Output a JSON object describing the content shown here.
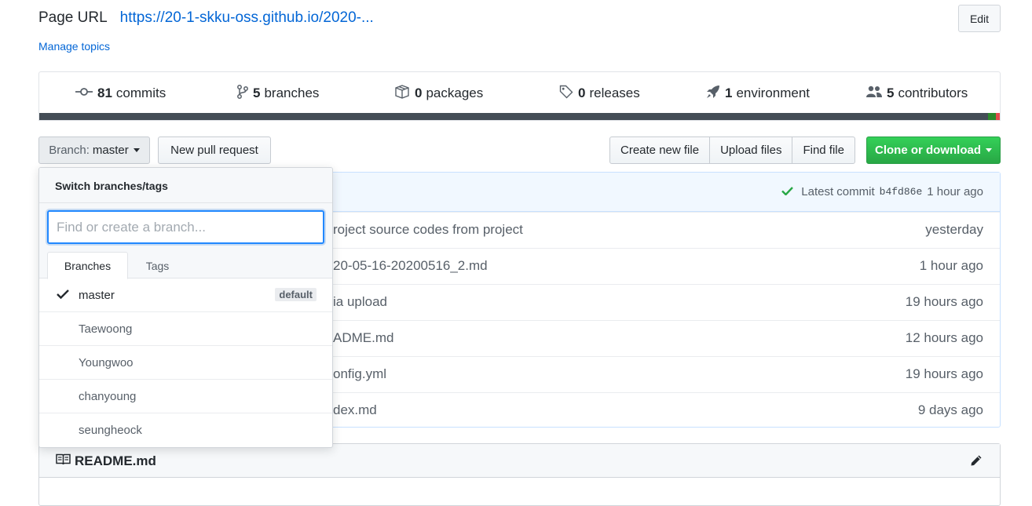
{
  "header": {
    "page_url_label": "Page URL",
    "page_url": "https://20-1-skku-oss.github.io/2020-...",
    "manage_topics": "Manage topics",
    "edit_label": "Edit"
  },
  "summary": [
    {
      "count": "81",
      "label": "commits",
      "icon": "commit-icon"
    },
    {
      "count": "5",
      "label": "branches",
      "icon": "branch-icon"
    },
    {
      "count": "0",
      "label": "packages",
      "icon": "package-icon"
    },
    {
      "count": "0",
      "label": "releases",
      "icon": "tag-icon"
    },
    {
      "count": "1",
      "label": "environment",
      "icon": "rocket-icon"
    },
    {
      "count": "5",
      "label": "contributors",
      "icon": "people-icon"
    }
  ],
  "language_bar": [
    {
      "color": "#444d56",
      "fraction": 0.988
    },
    {
      "color": "#2c8a2c",
      "fraction": 0.008
    },
    {
      "color": "#e34c4c",
      "fraction": 0.004
    }
  ],
  "toolbar": {
    "branch_prefix": "Branch:",
    "branch_name": "master",
    "new_pull_request": "New pull request",
    "create_new_file": "Create new file",
    "upload_files": "Upload files",
    "find_file": "Find file",
    "clone_or_download": "Clone or download"
  },
  "commit_bar": {
    "latest_commit_label": "Latest commit",
    "sha": "b4fd86e",
    "time": "1 hour ago"
  },
  "files": [
    {
      "message": "roject source codes from project",
      "age": "yesterday"
    },
    {
      "message": "20-05-16-20200516_2.md",
      "age": "1 hour ago"
    },
    {
      "message": "ia upload",
      "age": "19 hours ago"
    },
    {
      "message": "ADME.md",
      "age": "12 hours ago"
    },
    {
      "message": "onfig.yml",
      "age": "19 hours ago"
    },
    {
      "message": "dex.md",
      "age": "9 days ago"
    }
  ],
  "readme": {
    "title": "README.md"
  },
  "branch_dropdown": {
    "title": "Switch branches/tags",
    "filter_placeholder": "Find or create a branch...",
    "tabs": [
      "Branches",
      "Tags"
    ],
    "active_tab": "Branches",
    "items": [
      {
        "name": "master",
        "selected": true,
        "badge": "default"
      },
      {
        "name": "Taewoong",
        "selected": false
      },
      {
        "name": "Youngwoo",
        "selected": false
      },
      {
        "name": "chanyoung",
        "selected": false
      },
      {
        "name": "seungheock",
        "selected": false
      }
    ]
  },
  "colors": {
    "link": "#0366d6",
    "clone_button": "#28a745",
    "focus_ring": "#2188ff",
    "commit_bar_bg": "#f1f8ff"
  }
}
